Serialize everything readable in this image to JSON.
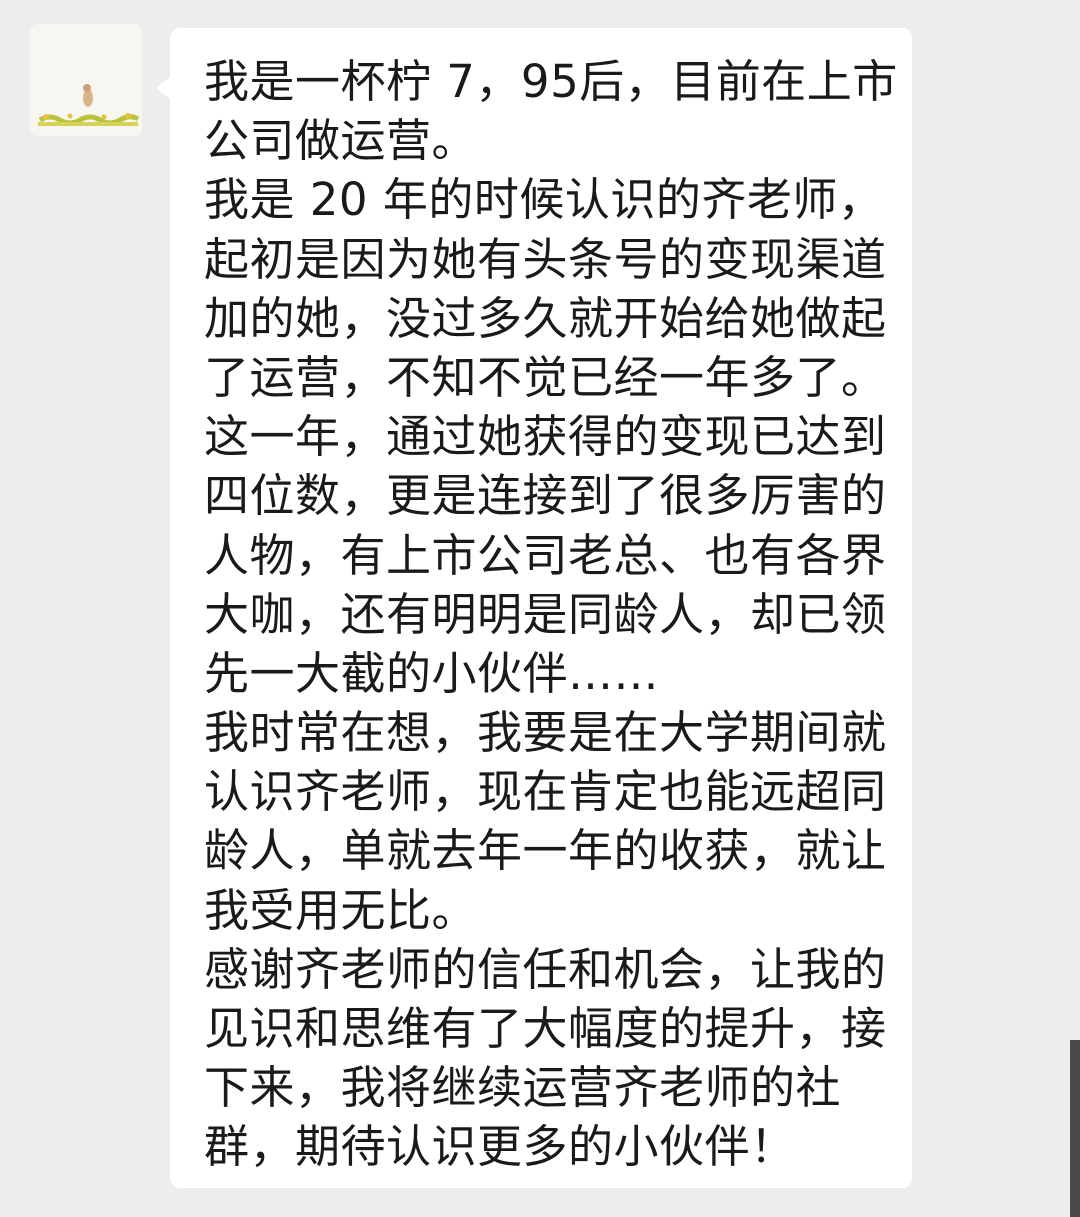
{
  "chat": {
    "message": {
      "lines": [
        "我是一杯柠 7，95后，目前在上市",
        "公司做运营。",
        "我是 20 年的时候认识的齐老师，",
        "起初是因为她有头条号的变现渠道",
        "加的她，没过多久就开始给她做起",
        "了运营，不知不觉已经一年多了。",
        "这一年，通过她获得的变现已达到",
        "四位数，更是连接到了很多厉害的",
        "人物，有上市公司老总、也有各界",
        "大咖，还有明明是同龄人，却已领",
        "先一大截的小伙伴……",
        "我时常在想，我要是在大学期间就",
        "认识齐老师，现在肯定也能远超同",
        "龄人，单就去年一年的收获，就让",
        "我受用无比。",
        "感谢齐老师的信任和机会，让我的",
        "见识和思维有了大幅度的提升，接",
        "下来，我将继续运营齐老师的社",
        "群，期待认识更多的小伙伴！"
      ]
    }
  },
  "colors": {
    "background": "#ededed",
    "bubble": "#ffffff",
    "text": "#1a1a1a"
  }
}
